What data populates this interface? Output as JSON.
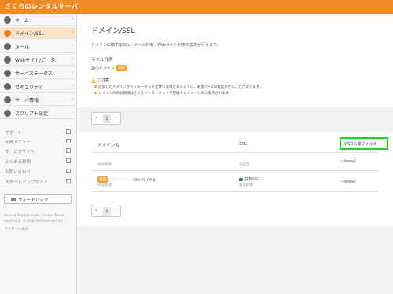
{
  "app": {
    "brand": "さくらのレンタルサーバ"
  },
  "sidebar": {
    "items": [
      {
        "label": "ホーム",
        "icon": "home-icon",
        "active": false
      },
      {
        "label": "ドメイン/SSL",
        "icon": "globe-icon",
        "active": true
      },
      {
        "label": "メール",
        "icon": "mail-icon",
        "active": false
      },
      {
        "label": "Webサイト/データ",
        "icon": "web-icon",
        "active": false
      },
      {
        "label": "サーバステータス",
        "icon": "server-icon",
        "active": false
      },
      {
        "label": "セキュリティ",
        "icon": "shield-icon",
        "active": false
      },
      {
        "label": "サーバ情報",
        "icon": "info-icon",
        "active": false
      },
      {
        "label": "スクリプト設定",
        "icon": "script-icon",
        "active": false
      }
    ],
    "sub_items": [
      {
        "label": "サポート"
      },
      {
        "label": "会員メニュー"
      },
      {
        "label": "サービスサイト"
      },
      {
        "label": "よくある質問"
      },
      {
        "label": "お問い合わせ"
      },
      {
        "label": "スタートアップガイド"
      }
    ],
    "feedback_label": "フィードバック",
    "footer": [
      "Sakura Rentalserver Control Panel",
      "Version 2. © SAKURA Internet Inc.",
      "ライセンス表記"
    ]
  },
  "main": {
    "title": "ドメイン/SSL",
    "description": "ドメインに関するSSL、メール利用、Webサイト利用の設定が行えます。",
    "legend_heading": "ラベル凡例",
    "legend_text": "誰のドメイン",
    "legend_badge": "初期",
    "notice_heading": "ご注意",
    "notices": [
      "追加したドメインがインターネット全体へ反映されるまでに、最長で一2日程度かかることがあります。",
      "ドメインの有効期限はさくらインターネットが管理するドメインのみ表示されます。"
    ],
    "pager_prev": "‹",
    "pager_page": "1",
    "pager_next": "›",
    "table": {
      "headers": {
        "domain": "ドメイン名",
        "ssl": "SSL",
        "web": "WEB公開フォルダ"
      },
      "rows": [
        {
          "badge": "",
          "domain": "",
          "sub": "有効期限 ",
          "ssl": "",
          "ssl_sub": "未設定",
          "web": "~/www/"
        },
        {
          "badge": "初期",
          "domain": "sakura.ne.jp",
          "sub": "有効期限 ",
          "ssl": "共有SSL",
          "ssl_sub": "有効期限 ",
          "web": "~/www/"
        }
      ]
    }
  },
  "colors": {
    "brand_orange": "#f08a24",
    "active_bg": "#fbe3c9",
    "highlight_green": "#21d321",
    "badge_orange": "#f0a030"
  }
}
